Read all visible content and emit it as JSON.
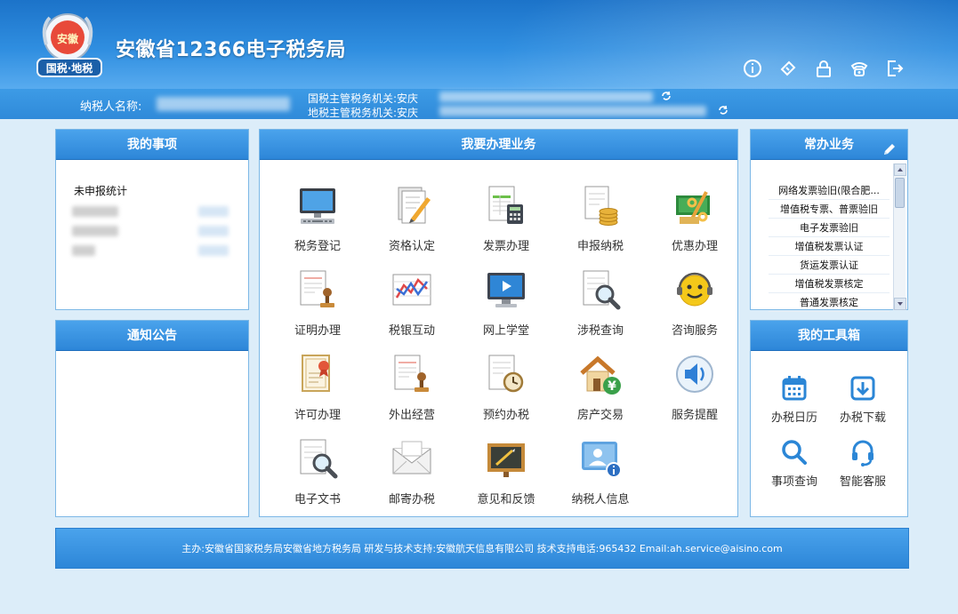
{
  "header": {
    "logo_text": "国税·地税",
    "logo_badge": "安徽",
    "site_title": "安徽省12366电子税务局"
  },
  "header_icons": [
    "info-icon",
    "ticket-icon",
    "lock-icon",
    "phone-icon",
    "logout-icon"
  ],
  "infobar": {
    "taxpayer_label": "纳税人名称:",
    "national_tax_label": "国税主管税务机关:安庆",
    "local_tax_label": "地税主管税务机关:安庆"
  },
  "my_items": {
    "title": "我的事项",
    "pending_title": "未申报统计"
  },
  "notice": {
    "title": "通知公告"
  },
  "business": {
    "title": "我要办理业务",
    "items": [
      {
        "label": "税务登记",
        "icon": "computer-icon"
      },
      {
        "label": "资格认定",
        "icon": "document-pencil-icon"
      },
      {
        "label": "发票办理",
        "icon": "invoice-calculator-icon"
      },
      {
        "label": "申报纳税",
        "icon": "coins-document-icon"
      },
      {
        "label": "优惠办理",
        "icon": "discount-icon"
      },
      {
        "label": "证明办理",
        "icon": "stamp-document-icon"
      },
      {
        "label": "税银互动",
        "icon": "chart-icon"
      },
      {
        "label": "网上学堂",
        "icon": "video-monitor-icon"
      },
      {
        "label": "涉税查询",
        "icon": "magnifier-document-icon"
      },
      {
        "label": "咨询服务",
        "icon": "smiley-headset-icon"
      },
      {
        "label": "许可办理",
        "icon": "certificate-icon"
      },
      {
        "label": "外出经营",
        "icon": "stamp-document-icon"
      },
      {
        "label": "预约办税",
        "icon": "clock-document-icon"
      },
      {
        "label": "房产交易",
        "icon": "house-yuan-icon"
      },
      {
        "label": "服务提醒",
        "icon": "speaker-icon"
      },
      {
        "label": "电子文书",
        "icon": "magnifier-document-icon"
      },
      {
        "label": "邮寄办税",
        "icon": "envelope-icon"
      },
      {
        "label": "意见和反馈",
        "icon": "chalkboard-icon"
      },
      {
        "label": "纳税人信息",
        "icon": "user-card-icon"
      }
    ]
  },
  "common": {
    "title": "常办业务",
    "items": [
      "网络发票验旧(限合肥...",
      "增值税专票、普票验旧",
      "电子发票验旧",
      "增值税发票认证",
      "货运发票认证",
      "增值税发票核定",
      "普通发票核定"
    ]
  },
  "toolbox": {
    "title": "我的工具箱",
    "items": [
      {
        "label": "办税日历",
        "icon": "calendar-icon"
      },
      {
        "label": "办税下载",
        "icon": "download-icon"
      },
      {
        "label": "事项查询",
        "icon": "search-icon"
      },
      {
        "label": "智能客服",
        "icon": "headset-icon"
      }
    ]
  },
  "footer": {
    "text": "主办:安徽省国家税务局安徽省地方税务局    研发与技术支持:安徽航天信息有限公司 技术支持电话:965432 Email:ah.service@aisino.com"
  },
  "colors": {
    "header_blue": "#1c73c9",
    "panel_head_blue": "#2d86d8",
    "page_bg": "#dcedf9"
  }
}
